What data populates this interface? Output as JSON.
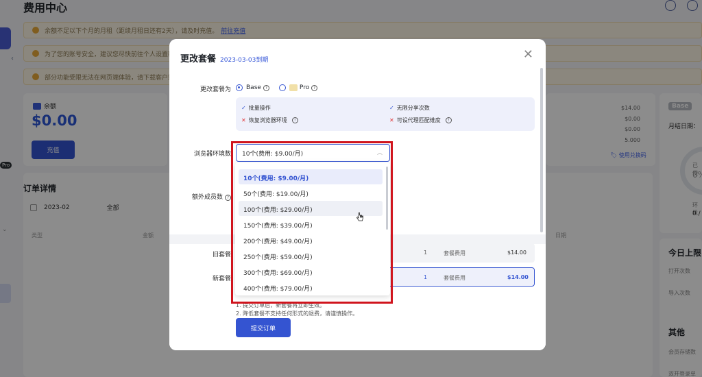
{
  "page": {
    "title": "费用中心",
    "notices": [
      {
        "text": "余额不足以下个月的月租（距续月租日还有2天），请及时充值。",
        "link": "前往充值"
      },
      {
        "text": "为了您的账号安全，建议您尽快前往个人设置新时",
        "link": ""
      },
      {
        "text": "部分功能受限无法在网页端体验，请下载客户端体验",
        "link": ""
      }
    ]
  },
  "balance": {
    "label": "余额",
    "value": "$0.00",
    "recharge_label": "充值"
  },
  "orders": {
    "title": "订单详情",
    "month": "2023-02",
    "filter_all": "全部",
    "col_type": "类型",
    "col_amount": "金额",
    "col_date": "日期"
  },
  "side_prices": [
    "$14.00",
    "$0.00",
    "$0.00",
    "5.000"
  ],
  "coupon_label": "使用兑换码",
  "right_card": {
    "plan_badge": "Base",
    "billing_date_label": "月结日期：",
    "ring_text_1": "已使",
    "ring_text_2": "0%",
    "env_label": "环境",
    "env_value": "0 /",
    "today_limit_title": "今日上限",
    "open_count_label": "打开次数",
    "import_count_label": "导入次数",
    "other_title": "其他",
    "storage_label": "会员存储数",
    "switch_label": "双开登录单"
  },
  "modal": {
    "title": "更改套餐",
    "date": "2023-03-03到期",
    "change_plan_label": "更改套餐为",
    "plan_base": "Base",
    "plan_pro": "Pro",
    "features": [
      {
        "ok": true,
        "text": "批量操作"
      },
      {
        "ok": true,
        "text": "无限分享次数"
      },
      {
        "ok": false,
        "text": "恢复浏览器环境"
      },
      {
        "ok": false,
        "text": "可设代理匹配维度"
      }
    ],
    "env_count_label": "浏览器环境数",
    "env_selected": "10个(费用: $9.00/月)",
    "options": [
      "10个(费用: $9.00/月)",
      "50个(费用: $19.00/月)",
      "100个(费用: $29.00/月)",
      "150个(费用: $39.00/月)",
      "200个(费用: $49.00/月)",
      "250个(费用: $59.00/月)",
      "300个(费用: $69.00/月)",
      "400个(费用: $79.00/月)"
    ],
    "extra_members_label": "额外成员数",
    "old_plan_label": "旧套餐",
    "new_plan_label": "新套餐",
    "old_row": {
      "qty": "1",
      "item": "套餐费用",
      "price": "$14.00"
    },
    "new_row": {
      "qty": "1",
      "item": "套餐费用",
      "price": "$14.00"
    },
    "note_1": "1. 提交订单后，新套餐将立即生效。",
    "note_2": "2. 降低套餐不支持任何形式的退费，请谨慎操作。",
    "submit_label": "提交订单"
  },
  "colors": {
    "accent": "#3454d1",
    "highlight": "#d0141d",
    "overlay": "rgba(0,0,0,0.45)"
  }
}
